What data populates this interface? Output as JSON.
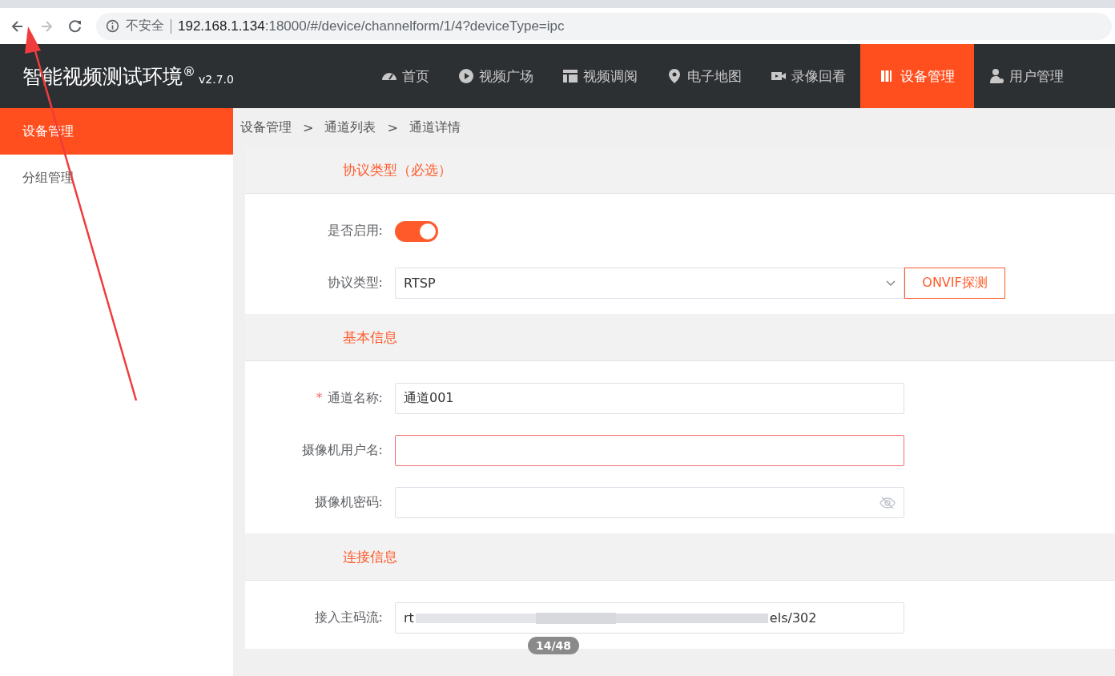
{
  "browser": {
    "security": "不安全",
    "url_host": "192.168.1.134",
    "url_rest": ":18000/#/device/channelform/1/4?deviceType=ipc"
  },
  "app": {
    "title": "智能视频测试环境",
    "title_mark": "®",
    "version": "v2.7.0"
  },
  "nav": [
    {
      "label": "首页",
      "selected": false
    },
    {
      "label": "视频广场",
      "selected": false
    },
    {
      "label": "视频调阅",
      "selected": false
    },
    {
      "label": "电子地图",
      "selected": false
    },
    {
      "label": "录像回看",
      "selected": false
    },
    {
      "label": "设备管理",
      "selected": true
    },
    {
      "label": "用户管理",
      "selected": false
    }
  ],
  "sidebar": {
    "items": [
      {
        "label": "设备管理",
        "selected": true
      },
      {
        "label": "分组管理",
        "selected": false
      }
    ]
  },
  "breadcrumb": [
    "设备管理",
    "通道列表",
    "通道详情"
  ],
  "breadcrumb_separator": ">",
  "sections": [
    {
      "title": "协议类型（必选）",
      "fields": [
        {
          "kind": "switch",
          "label": "是否启用:",
          "on": true
        },
        {
          "kind": "select",
          "label": "协议类型:",
          "value": "RTSP",
          "button": "ONVIF探测"
        }
      ]
    },
    {
      "title": "基本信息",
      "fields": [
        {
          "kind": "text",
          "label": "通道名称:",
          "required_mark": "*",
          "value": "通道001",
          "error": false
        },
        {
          "kind": "text",
          "label": "摄像机用户名:",
          "error": true
        },
        {
          "kind": "password",
          "label": "摄像机密码:"
        }
      ]
    },
    {
      "title": "连接信息",
      "fields": [
        {
          "kind": "blurred",
          "label": "接入主码流:",
          "value_start": "rt",
          "value_end": "els/302"
        }
      ]
    }
  ],
  "page_counter": "14/48"
}
